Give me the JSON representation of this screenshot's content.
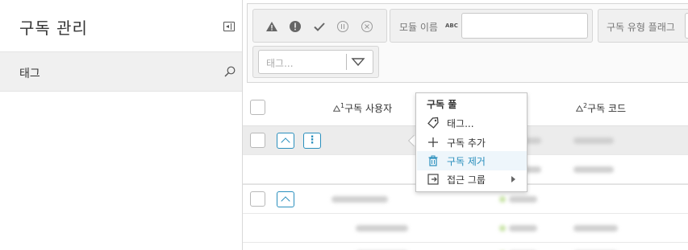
{
  "sidebar": {
    "title": "구독 관리",
    "item_label": "태그",
    "icons": {
      "collapse": "collapse-panel-icon",
      "search": "search-icon"
    }
  },
  "filters": {
    "status_icons": [
      "warning-icon",
      "error-icon",
      "check-icon",
      "pause-icon",
      "cancel-icon"
    ],
    "module_label": "모듈 이름",
    "module_type_badge": "ABC",
    "module_value": "",
    "flag_label": "구독 유형 플래그",
    "tag_placeholder": "태그..."
  },
  "table": {
    "columns": [
      "구독 사용자",
      "구독 코드"
    ],
    "sort_prefixes": [
      "1",
      "2"
    ]
  },
  "context_menu": {
    "title": "구독 풀",
    "items": [
      {
        "label": "태그...",
        "icon": "tag-icon"
      },
      {
        "label": "구독 추가",
        "icon": "plus-icon"
      },
      {
        "label": "구독 제거",
        "icon": "trash-icon",
        "active": true
      },
      {
        "label": "접근 그룹",
        "icon": "access-group-icon",
        "submenu": true
      }
    ]
  },
  "colors": {
    "accent": "#2a8fbd",
    "sidebar_selected": "#f0f0f0",
    "row_selected": "#ececec"
  }
}
